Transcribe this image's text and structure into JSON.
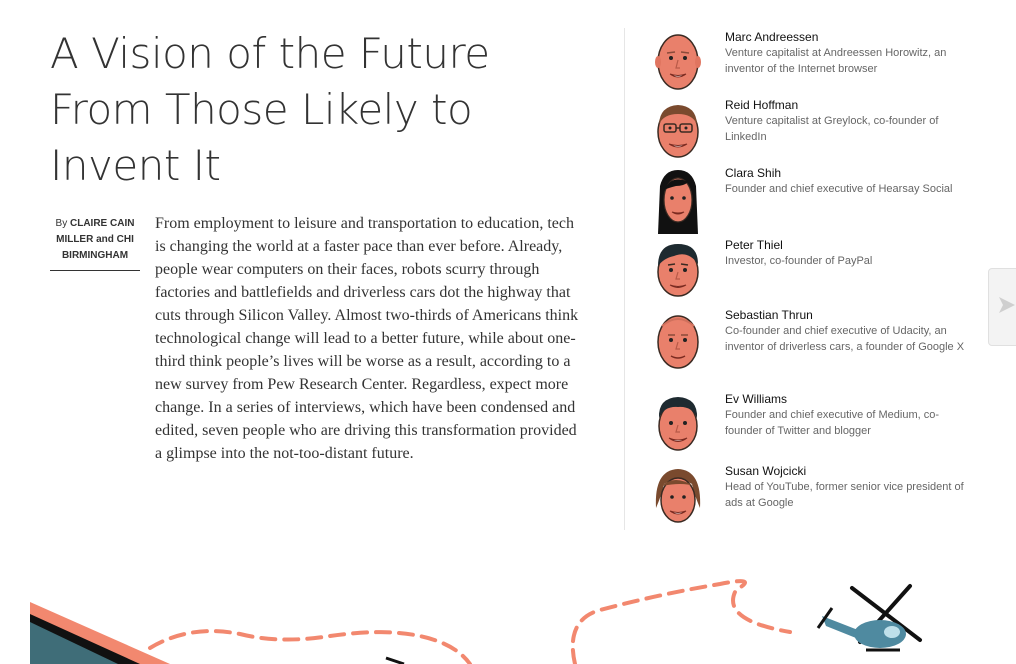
{
  "article": {
    "headline": "A Vision of the Future From Those Likely to Invent It",
    "byline": {
      "prefix": "By",
      "authors": "CLAIRE CAIN MILLER and CHI BIRMINGHAM"
    },
    "summary": "From employment to leisure and transportation to education, tech is changing the world at a faster pace than ever before. Already, people wear computers on their faces, robots scurry through factories and battlefields and driverless cars dot the highway that cuts through Silicon Valley. Almost two-thirds of Americans think technological change will lead to a better future, while about one-third think people’s lives will be worse as a result, according to a new survey from Pew Research Center. Regardless, expect more change. In a series of interviews, which have been condensed and edited, seven people who are driving this transformation provided a glimpse into the not-too-distant future."
  },
  "people": [
    {
      "name": "Marc Andreessen",
      "role": "Venture capitalist at Andreessen Horowitz, an inventor of the Internet browser"
    },
    {
      "name": "Reid Hoffman",
      "role": "Venture capitalist at Greylock, co-founder of LinkedIn"
    },
    {
      "name": "Clara Shih",
      "role": "Founder and chief executive of Hearsay Social"
    },
    {
      "name": "Peter Thiel",
      "role": "Investor, co-founder of PayPal"
    },
    {
      "name": "Sebastian Thrun",
      "role": "Co-founder and chief executive of Udacity, an inventor of driverless cars, a founder of Google X"
    },
    {
      "name": "Ev Williams",
      "role": "Founder and chief executive of Medium, co-founder of Twitter and blogger"
    },
    {
      "name": "Susan Wojcicki",
      "role": "Head of YouTube, former senior vice president of ads at Google"
    }
  ],
  "colors": {
    "skin": "#e9806b",
    "coral": "#f2886f",
    "teal": "#3f6d78",
    "dark": "#111111",
    "muted_text": "#666666"
  },
  "icons": {
    "next": "chevron-right-icon",
    "helicopter": "helicopter-icon"
  }
}
